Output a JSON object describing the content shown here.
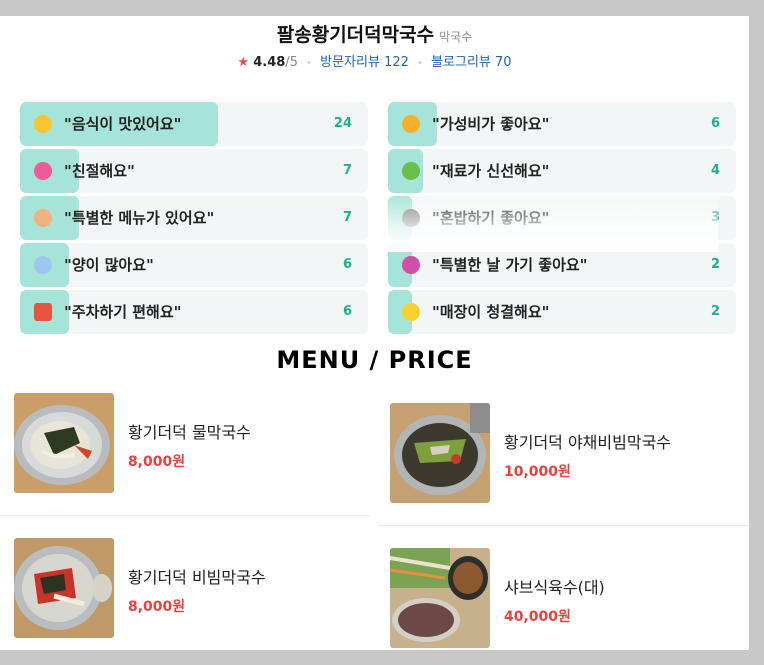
{
  "restaurant": {
    "name": "팔송황기더덕막국수",
    "category": "막국수",
    "rating": "4.48",
    "rating_max": "/5",
    "visitor_reviews": "방문자리뷰 122",
    "blog_reviews": "블로그리뷰 70"
  },
  "keywords_left": [
    {
      "label": "\"음식이 맛있어요\"",
      "count": "24",
      "ratio": 0.57,
      "icon": "smiley-icon",
      "color": "#f7c531"
    },
    {
      "label": "\"친절해요\"",
      "count": "7",
      "ratio": 0.17,
      "icon": "heart-icon",
      "color": "#ef5a9a"
    },
    {
      "label": "\"특별한 메뉴가 있어요\"",
      "count": "7",
      "ratio": 0.17,
      "icon": "chef-icon",
      "color": "#f0b37e"
    },
    {
      "label": "\"양이 많아요\"",
      "count": "6",
      "ratio": 0.14,
      "icon": "bowl-icon",
      "color": "#9cc7ee"
    },
    {
      "label": "\"주차하기 편해요\"",
      "count": "6",
      "ratio": 0.14,
      "icon": "parking-icon",
      "color": "#e8553f"
    }
  ],
  "keywords_right": [
    {
      "label": "\"가성비가 좋아요\"",
      "count": "6",
      "ratio": 0.14,
      "icon": "thumb-icon",
      "color": "#f2b02d"
    },
    {
      "label": "\"재료가 신선해요\"",
      "count": "4",
      "ratio": 0.1,
      "icon": "leaf-icon",
      "color": "#6abf4b"
    },
    {
      "label": "\"혼밥하기 좋아요\"",
      "count": "3",
      "ratio": 0.07,
      "icon": "riceball-icon",
      "color": "#7d7d7d"
    },
    {
      "label": "\"특별한 날 가기 좋아요\"",
      "count": "2",
      "ratio": 0.05,
      "icon": "bouquet-icon",
      "color": "#d14fa4"
    },
    {
      "label": "\"매장이 청결해요\"",
      "count": "2",
      "ratio": 0.05,
      "icon": "sparkle-icon",
      "color": "#f7d22f"
    }
  ],
  "menu": {
    "title": "MENU / PRICE",
    "items": [
      {
        "name": "황기더덕 물막국수",
        "price": "8,000원"
      },
      {
        "name": "황기더덕 야채비빔막국수",
        "price": "10,000원"
      },
      {
        "name": "황기더덕 비빔막국수",
        "price": "8,000원"
      },
      {
        "name": "샤브식육수(대)",
        "price": "40,000원"
      }
    ]
  },
  "colors": {
    "accent_bar": "#a6e3d8",
    "count": "#19b28e",
    "price": "#e8413b",
    "link": "#1e63b3",
    "star": "#f34949"
  }
}
